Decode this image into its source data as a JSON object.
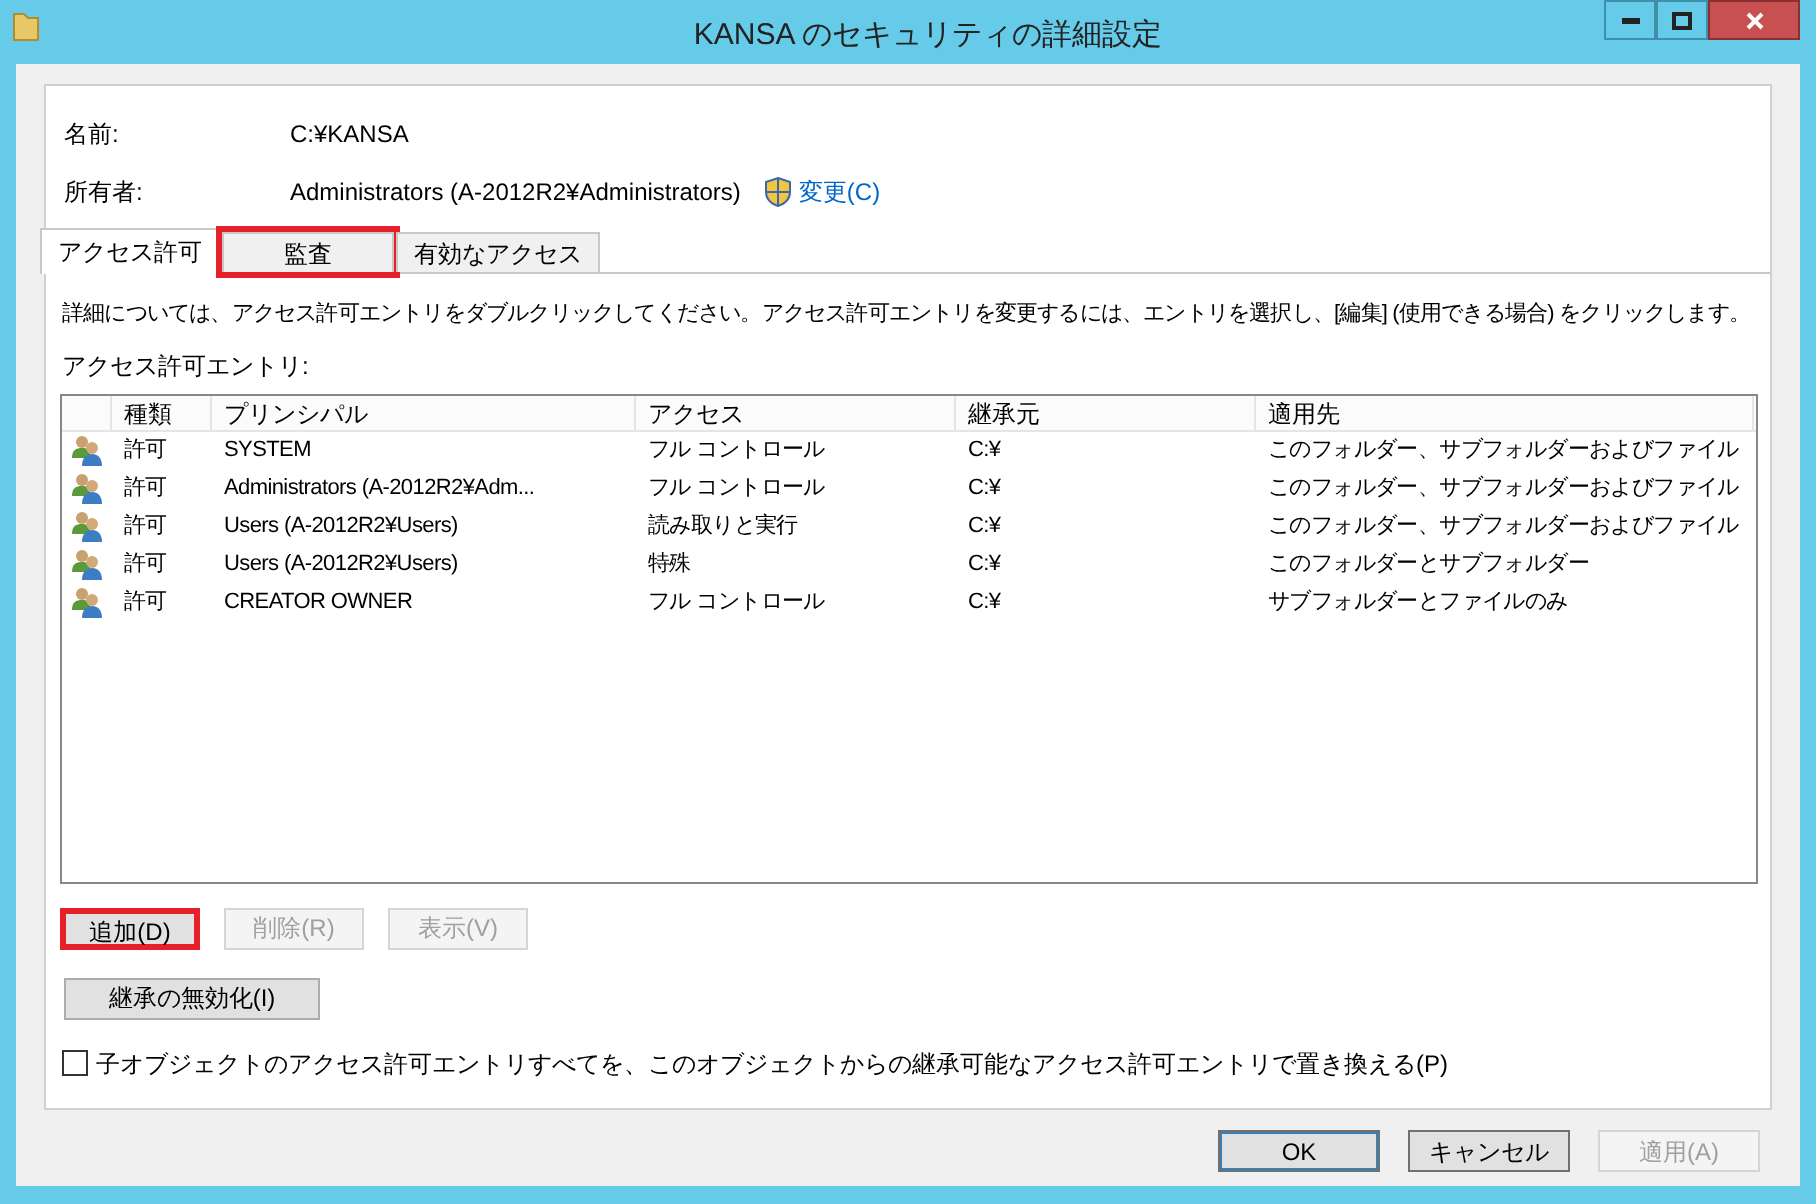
{
  "window": {
    "title": "KANSA のセキュリティの詳細設定"
  },
  "name": {
    "label": "名前:",
    "value": "C:¥KANSA"
  },
  "owner": {
    "label": "所有者:",
    "value": "Administrators (A-2012R2¥Administrators)",
    "change_link": "変更(C)"
  },
  "tabs": [
    {
      "label": "アクセス許可",
      "selected": true,
      "highlighted": false
    },
    {
      "label": "監査",
      "selected": false,
      "highlighted": true
    },
    {
      "label": "有効なアクセス",
      "selected": false,
      "highlighted": false
    }
  ],
  "description": "詳細については、アクセス許可エントリをダブルクリックしてください。アクセス許可エントリを変更するには、エントリを選択し、[編集] (使用できる場合) をクリックします。",
  "entries_label": "アクセス許可エントリ:",
  "table": {
    "columns": [
      "種類",
      "プリンシパル",
      "アクセス",
      "継承元",
      "適用先"
    ],
    "rows": [
      [
        "許可",
        "SYSTEM",
        "フル コントロール",
        "C:¥",
        "このフォルダー、サブフォルダーおよびファイル"
      ],
      [
        "許可",
        "Administrators (A-2012R2¥Adm...",
        "フル コントロール",
        "C:¥",
        "このフォルダー、サブフォルダーおよびファイル"
      ],
      [
        "許可",
        "Users (A-2012R2¥Users)",
        "読み取りと実行",
        "C:¥",
        "このフォルダー、サブフォルダーおよびファイル"
      ],
      [
        "許可",
        "Users (A-2012R2¥Users)",
        "特殊",
        "C:¥",
        "このフォルダーとサブフォルダー"
      ],
      [
        "許可",
        "CREATOR OWNER",
        "フル コントロール",
        "C:¥",
        "サブフォルダーとファイルのみ"
      ]
    ]
  },
  "entry_buttons": [
    {
      "label": "追加(D)",
      "disabled": false,
      "highlighted": true
    },
    {
      "label": "削除(R)",
      "disabled": true,
      "highlighted": false
    },
    {
      "label": "表示(V)",
      "disabled": true,
      "highlighted": false
    }
  ],
  "disable_inheritance_button": "継承の無効化(I)",
  "replace_checkbox": {
    "label": "子オブジェクトのアクセス許可エントリすべてを、このオブジェクトからの継承可能なアクセス許可エントリで置き換える(P)",
    "checked": false
  },
  "dialog_buttons": [
    {
      "label": "OK",
      "disabled": false,
      "default": true
    },
    {
      "label": "キャンセル",
      "disabled": false,
      "default": false
    },
    {
      "label": "適用(A)",
      "disabled": true,
      "default": false
    }
  ]
}
